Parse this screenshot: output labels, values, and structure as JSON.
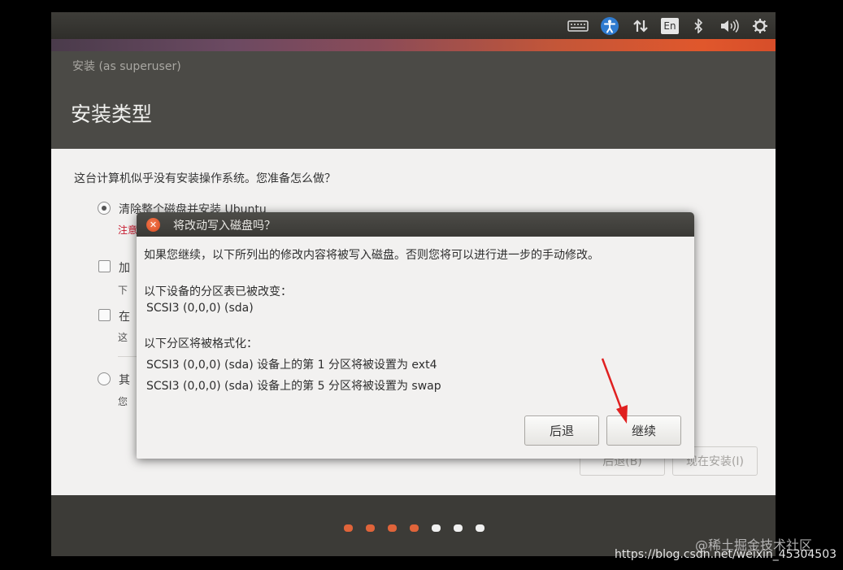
{
  "window": {
    "title": "安装 (as superuser)",
    "page_title": "安装类型"
  },
  "tray": {
    "keyboard_icon": "keyboard-icon",
    "accessibility_icon": "accessibility-icon",
    "network_icon": "network-updown-icon",
    "language": "En",
    "bluetooth_icon": "bluetooth-icon",
    "volume_icon": "volume-icon",
    "power_icon": "gear-power-icon"
  },
  "installer": {
    "question": "这台计算机似乎没有安装操作系统。您准备怎么做？",
    "options": [
      {
        "label": "清除整个磁盘并安装 Ubuntu",
        "note": "注意",
        "selected": true
      },
      {
        "label": "加",
        "sub": "下"
      },
      {
        "label": "在",
        "sub": "这"
      },
      {
        "label": "其",
        "sub": "您"
      }
    ],
    "back_button": "后退(B)",
    "install_button": "现在安装(I)"
  },
  "progress_dots": {
    "total": 7,
    "completed": 4,
    "colors": {
      "done": "#e0643a",
      "todo": "#f0f0f0"
    }
  },
  "dialog": {
    "title": "将改动写入磁盘吗？",
    "intro": "如果您继续，以下所列出的修改内容将被写入磁盘。否则您将可以进行进一步的手动修改。",
    "partition_table_heading": "以下设备的分区表已被改变：",
    "partition_table_devices": [
      "SCSI3 (0,0,0) (sda)"
    ],
    "format_heading": "以下分区将被格式化：",
    "format_items": [
      "SCSI3 (0,0,0) (sda) 设备上的第 1 分区将被设置为 ext4",
      "SCSI3 (0,0,0) (sda) 设备上的第 5 分区将被设置为 swap"
    ],
    "back_button": "后退",
    "continue_button": "继续"
  },
  "watermarks": {
    "juejin": "@稀土掘金技术社区",
    "csdn": "https://blog.csdn.net/weixin_45304503"
  },
  "colors": {
    "accent_orange": "#e0572c",
    "annotation_arrow": "#e02020",
    "warning_red": "#c7162b"
  }
}
